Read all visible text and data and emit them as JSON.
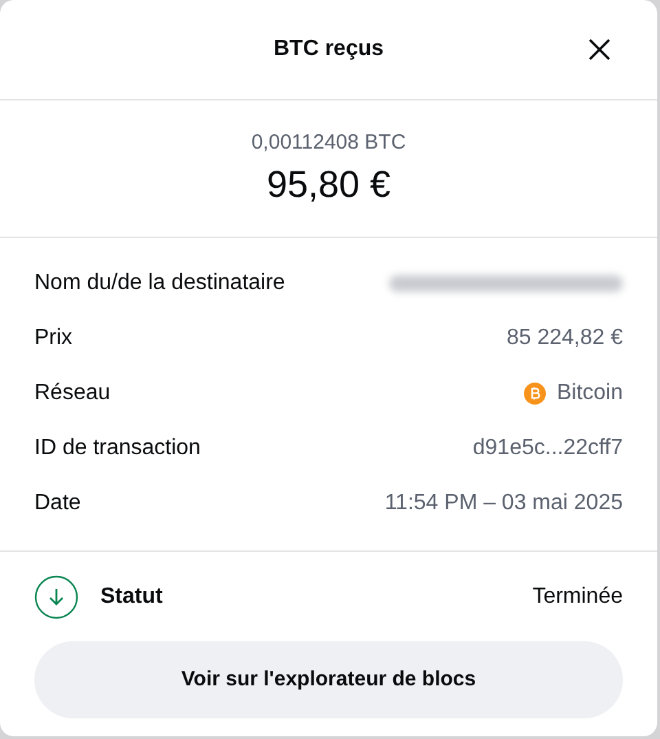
{
  "dialog": {
    "title": "BTC reçus"
  },
  "amount": {
    "crypto": "0,00112408 BTC",
    "fiat": "95,80 €"
  },
  "details": [
    {
      "kind": "redacted",
      "label": "Nom du/de la destinataire"
    },
    {
      "kind": "text",
      "label": "Prix",
      "value": "85 224,82 €"
    },
    {
      "kind": "network",
      "label": "Réseau",
      "value": "Bitcoin"
    },
    {
      "kind": "text",
      "label": "ID de transaction",
      "value": "d91e5c...22cff7"
    },
    {
      "kind": "text",
      "label": "Date",
      "value": "11:54 PM – 03 mai 2025"
    }
  ],
  "status": {
    "label": "Statut",
    "value": "Terminée"
  },
  "button": "Voir sur l'explorateur de blocs"
}
